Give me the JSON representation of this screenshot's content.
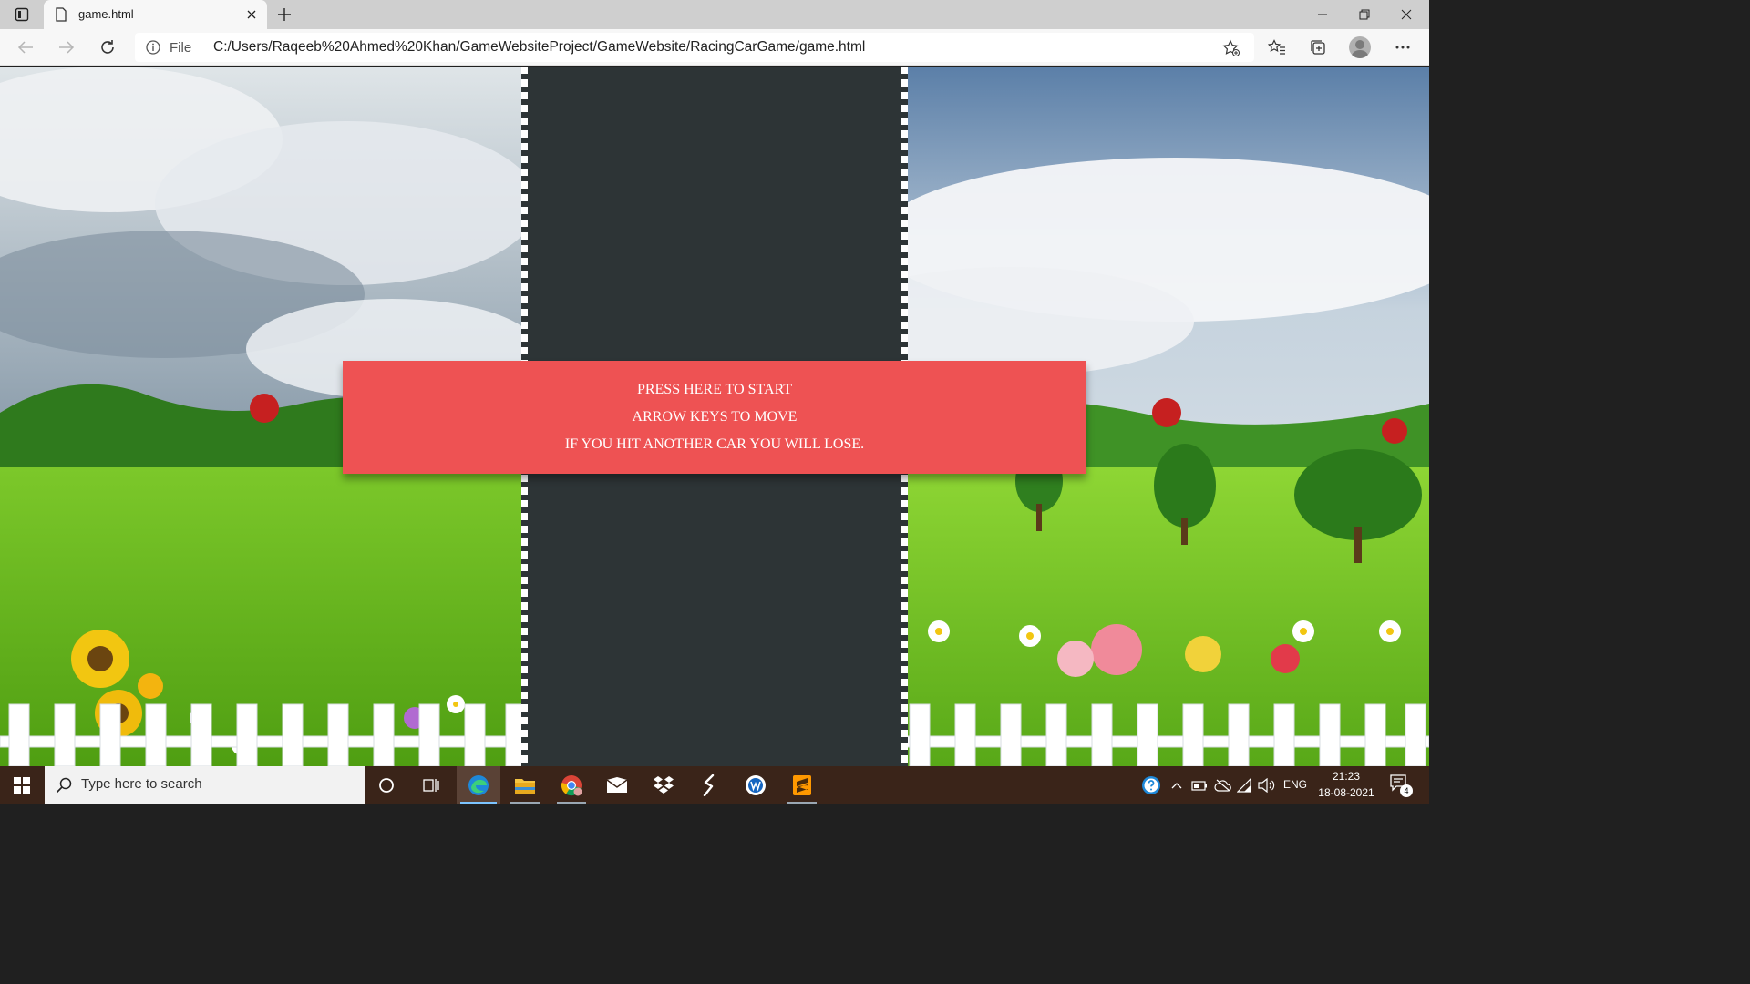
{
  "browser": {
    "tab_title": "game.html",
    "file_label": "File",
    "url": "C:/Users/Raqeeb%20Ahmed%20Khan/GameWebsiteProject/GameWebsite/RacingCarGame/game.html"
  },
  "game": {
    "start_lines": [
      "PRESS HERE TO START",
      "ARROW KEYS TO MOVE",
      "IF YOU HIT ANOTHER CAR YOU WILL LOSE."
    ],
    "colors": {
      "road": "#2d3436",
      "start_banner": "#ee5253",
      "lane_marks": "#ffffff"
    }
  },
  "taskbar": {
    "search_placeholder": "Type here to search",
    "apps": [
      "cortana-icon",
      "task-view-icon",
      "edge-icon",
      "file-explorer-icon",
      "chrome-icon",
      "mail-icon",
      "dropbox-icon",
      "app-s-icon",
      "app-w-icon",
      "sublime-text-icon"
    ],
    "language": "ENG",
    "time": "21:23",
    "date": "18-08-2021",
    "notification_count": "4"
  }
}
